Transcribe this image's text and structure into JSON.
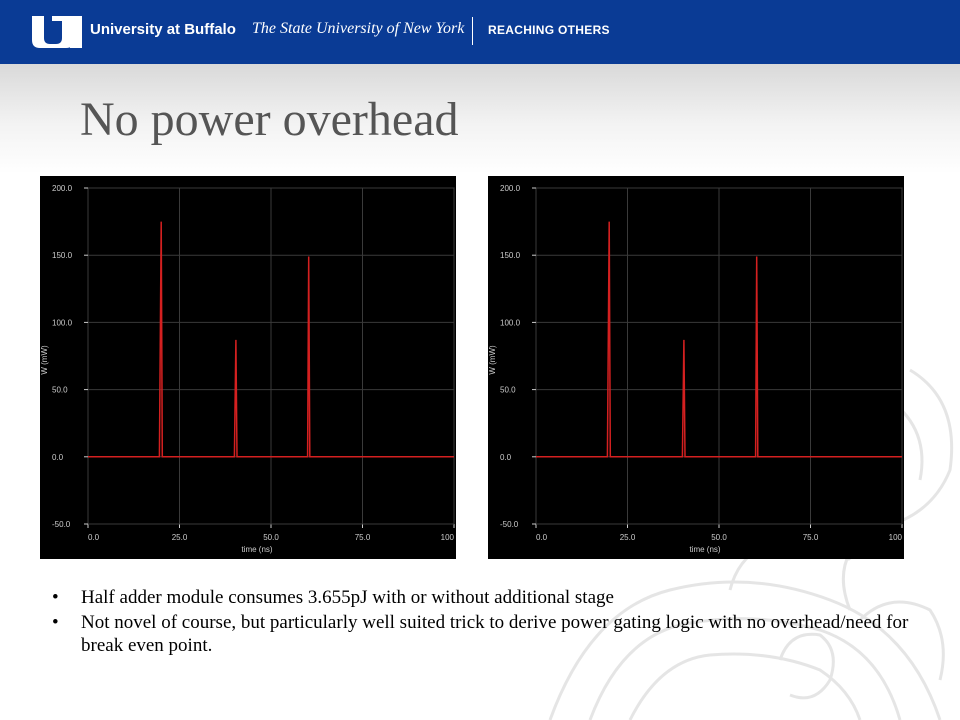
{
  "header": {
    "logo_text": "UB",
    "university_name": "University at Buffalo",
    "system_name": "The State University of New York",
    "tagline": "REACHING OTHERS"
  },
  "slide": {
    "title": "No power overhead",
    "bullets": [
      "Half adder module consumes 3.655pJ with or without additional stage",
      "Not novel of course, but particularly well suited trick to derive power gating logic with no overhead/need for break even point."
    ]
  },
  "chart_data": [
    {
      "type": "line",
      "xlabel": "time (ns)",
      "ylabel": "W (mW)",
      "xlim": [
        0,
        100
      ],
      "ylim": [
        -50,
        200
      ],
      "x_ticks": [
        "0.0",
        "25.0",
        "50.0",
        "75.0",
        "100"
      ],
      "y_ticks": [
        "200.0",
        "150.0",
        "100.0",
        "50.0",
        "0.0",
        "-50.0"
      ],
      "grid": true,
      "series": [
        {
          "color": "#d42020",
          "x": [
            0,
            19.5,
            20,
            20.3,
            40,
            40.4,
            40.7,
            60,
            60.3,
            60.6,
            100
          ],
          "y": [
            0,
            0,
            175,
            0,
            0,
            87,
            0,
            0,
            149,
            0,
            0
          ]
        }
      ]
    },
    {
      "type": "line",
      "xlabel": "time (ns)",
      "ylabel": "W (mW)",
      "xlim": [
        0,
        100
      ],
      "ylim": [
        -50,
        200
      ],
      "x_ticks": [
        "0.0",
        "25.0",
        "50.0",
        "75.0",
        "100"
      ],
      "y_ticks": [
        "200.0",
        "150.0",
        "100.0",
        "50.0",
        "0.0",
        "-50.0"
      ],
      "grid": true,
      "series": [
        {
          "color": "#d42020",
          "x": [
            0,
            19.5,
            20,
            20.3,
            40,
            40.4,
            40.7,
            60,
            60.3,
            60.6,
            100
          ],
          "y": [
            0,
            0,
            175,
            0,
            0,
            87,
            0,
            0,
            149,
            0,
            0
          ]
        }
      ]
    }
  ]
}
